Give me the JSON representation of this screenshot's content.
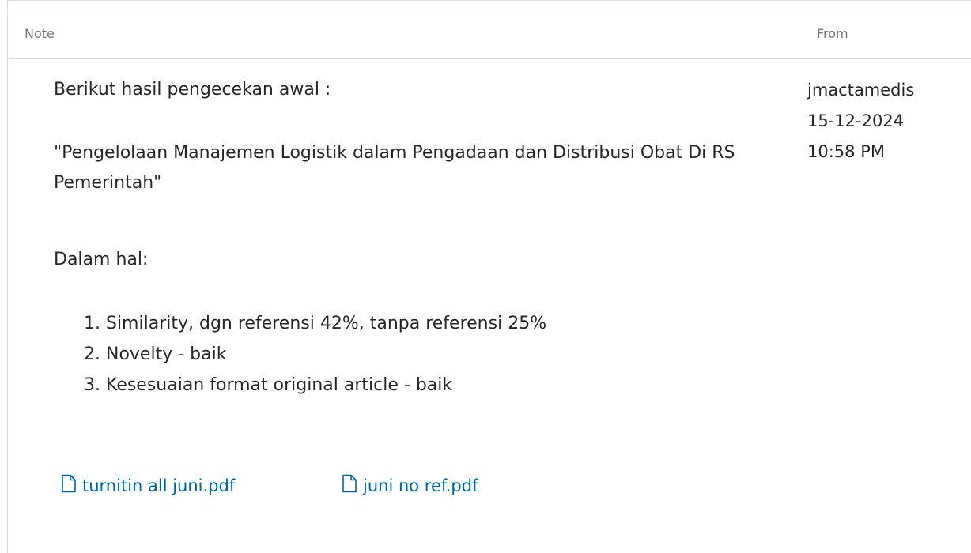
{
  "header": {
    "note_label": "Note",
    "from_label": "From"
  },
  "note": {
    "intro": "Berikut hasil pengecekan awal :",
    "title": "\"Pengelolaan Manajemen Logistik dalam Pengadaan dan Distribusi Obat Di RS Pemerintah\"",
    "dalam": "Dalam hal:",
    "items": [
      "1. Similarity, dgn referensi 42%, tanpa referensi 25%",
      "2. Novelty - baik",
      "3. Kesesuaian format original article - baik"
    ]
  },
  "from": {
    "user": "jmactamedis",
    "date": "15-12-2024",
    "time": "10:58 PM"
  },
  "attachments": [
    {
      "name": "turnitin all juni.pdf",
      "icon": "file-icon"
    },
    {
      "name": "juni no ref.pdf",
      "icon": "file-icon"
    }
  ],
  "colors": {
    "link": "#006798",
    "border": "#dddddd",
    "header_text": "#8a8a8a"
  }
}
